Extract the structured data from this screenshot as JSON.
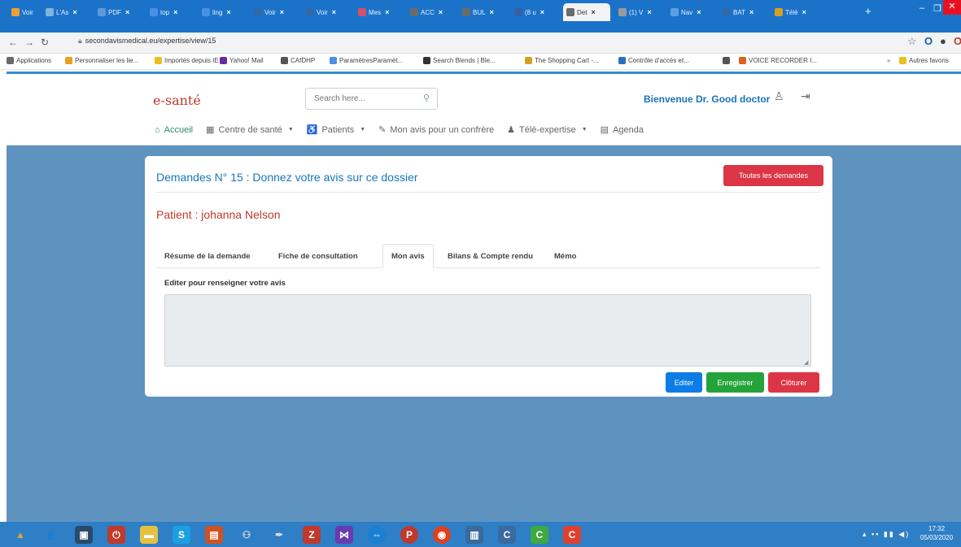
{
  "browser": {
    "tabs": [
      {
        "label": "Voir",
        "color": "#f0a030"
      },
      {
        "label": "L'As",
        "color": "#7fb3e0"
      },
      {
        "label": "PDF",
        "color": "#5a9ad8"
      },
      {
        "label": "top",
        "color": "#4a90e2"
      },
      {
        "label": "ling",
        "color": "#4a90e2"
      },
      {
        "label": "Voir",
        "color": "#2e6aa8"
      },
      {
        "label": "Voir",
        "color": "#2e6aa8"
      },
      {
        "label": "Mes",
        "color": "#d44f6a"
      },
      {
        "label": "ACC",
        "color": "#6a6a6a"
      },
      {
        "label": "BUL",
        "color": "#6a6a6a"
      },
      {
        "label": "(8 u",
        "color": "#3a5fa8"
      },
      {
        "label": "Det",
        "color": "#6a6a6a"
      },
      {
        "label": "(1) V",
        "color": "#9a9a9a"
      },
      {
        "label": "Nav",
        "color": "#5aa0e0"
      },
      {
        "label": "BAT",
        "color": "#2e6aa8"
      },
      {
        "label": "Télé",
        "color": "#d4a020"
      }
    ],
    "url": "secondavismedical.eu/expertise/view/15",
    "bookmarks": [
      {
        "label": "Applications",
        "color": "#6a6a6a"
      },
      {
        "label": "Personnaliser les lie...",
        "color": "#e8a020"
      },
      {
        "label": "Importés depuis IE",
        "color": "#e8c020"
      },
      {
        "label": "Yahoo! Mail",
        "color": "#6a2aa8"
      },
      {
        "label": "CAfDHP",
        "color": "#555555"
      },
      {
        "label": "ParamètresParamèt...",
        "color": "#4a90e2"
      },
      {
        "label": "Search Blends | Ble...",
        "color": "#333333"
      },
      {
        "label": "The Shopping Cart -...",
        "color": "#d4a020"
      },
      {
        "label": "Contrôle d'accès et...",
        "color": "#2a70c0"
      },
      {
        "label": "",
        "color": "#555555"
      },
      {
        "label": "VOICE RECORDER I...",
        "color": "#e06020"
      },
      {
        "label": "Autres favoris",
        "color": "#e8c020"
      }
    ]
  },
  "header": {
    "logo": "e-santé",
    "search_placeholder": "Search here...",
    "welcome": "Bienvenue Dr. Good doctor"
  },
  "nav": [
    {
      "label": "Accueil",
      "icon": "home-icon",
      "glyph": "⌂",
      "dropdown": false,
      "active": true
    },
    {
      "label": "Centre de santé",
      "icon": "hospital-icon",
      "glyph": "▦",
      "dropdown": true,
      "active": false
    },
    {
      "label": "Patients",
      "icon": "person-icon",
      "glyph": "♿",
      "dropdown": true,
      "active": false
    },
    {
      "label": "Mon avis pour un confrère",
      "icon": "edit-icon",
      "glyph": "✎",
      "dropdown": false,
      "active": false
    },
    {
      "label": "Télé-expertise",
      "icon": "doctor-icon",
      "glyph": "♟",
      "dropdown": true,
      "active": false
    },
    {
      "label": "Agenda",
      "icon": "calendar-icon",
      "glyph": "▤",
      "dropdown": false,
      "active": false
    }
  ],
  "card": {
    "title": "Demandes N° 15 : Donnez votre avis sur ce dossier",
    "all_demands_button": "Toutes les demandes",
    "patient": "Patient : johanna Nelson",
    "tabs": [
      {
        "label": "Résume de la demande",
        "active": false
      },
      {
        "label": "Fiche de consultation",
        "active": false
      },
      {
        "label": "Mon avis",
        "active": true
      },
      {
        "label": "Bilans & Compte rendu",
        "active": false
      },
      {
        "label": "Mémo",
        "active": false
      }
    ],
    "edit_label": "Editer pour renseigner votre avis",
    "opinion_value": "",
    "edit_button": "Editer",
    "save_button": "Enregistrer",
    "close_button": "Clôturer"
  },
  "taskbar": {
    "time": "17:32",
    "date": "05/03/2020"
  }
}
